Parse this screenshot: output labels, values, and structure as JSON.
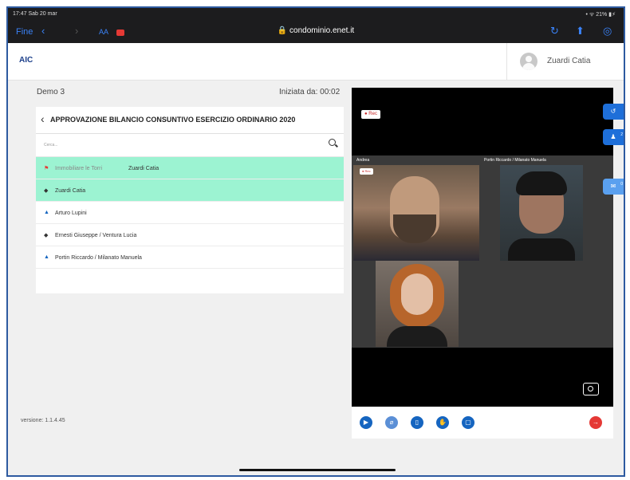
{
  "status_bar": {
    "time": "17:47  Sab 20 mar",
    "right": "• ᯤ 21% ▮⚡"
  },
  "browser": {
    "back_label": "Fine",
    "text_size_label": "AA",
    "url": "condominio.enet.it"
  },
  "header": {
    "logo": "AIC",
    "user_name": "Zuardi Catia"
  },
  "meeting": {
    "name": "Demo 3",
    "started_label": "Iniziata da: 00:02"
  },
  "panel": {
    "title": "APPROVAZIONE BILANCIO CONSUNTIVO ESERCIZIO ORDINARIO 2020",
    "search_placeholder": "Cerca...",
    "rows": [
      {
        "icon": "flag-icon",
        "label": "Immobiliare le Torri",
        "sublabel": "Zuardi Catia",
        "highlight": true
      },
      {
        "icon": "diamond-icon",
        "label": "Zuardi Catia",
        "sublabel": "",
        "highlight": true
      },
      {
        "icon": "person-icon",
        "label": "Arturo Lupini",
        "sublabel": "",
        "highlight": false
      },
      {
        "icon": "diamond-icon",
        "label": "Ernesti Giuseppe / Ventura Lucia",
        "sublabel": "",
        "highlight": false
      },
      {
        "icon": "person-icon",
        "label": "Portin Riccardo / Milanato Manuela",
        "sublabel": "",
        "highlight": false
      }
    ]
  },
  "version": "versione: 1.1.4.45",
  "video": {
    "rec_label": "● Rec",
    "tile_rec_label": "● Rec",
    "tiles": [
      {
        "label": "Andrea"
      },
      {
        "label": "Portin Riccardo / Milanato Manuela"
      }
    ]
  },
  "side_badges": {
    "participants_count": "2",
    "chat_count": "0"
  },
  "colors": {
    "accent": "#1565c0",
    "highlight_row": "#9cf3d2",
    "danger": "#e53935"
  }
}
